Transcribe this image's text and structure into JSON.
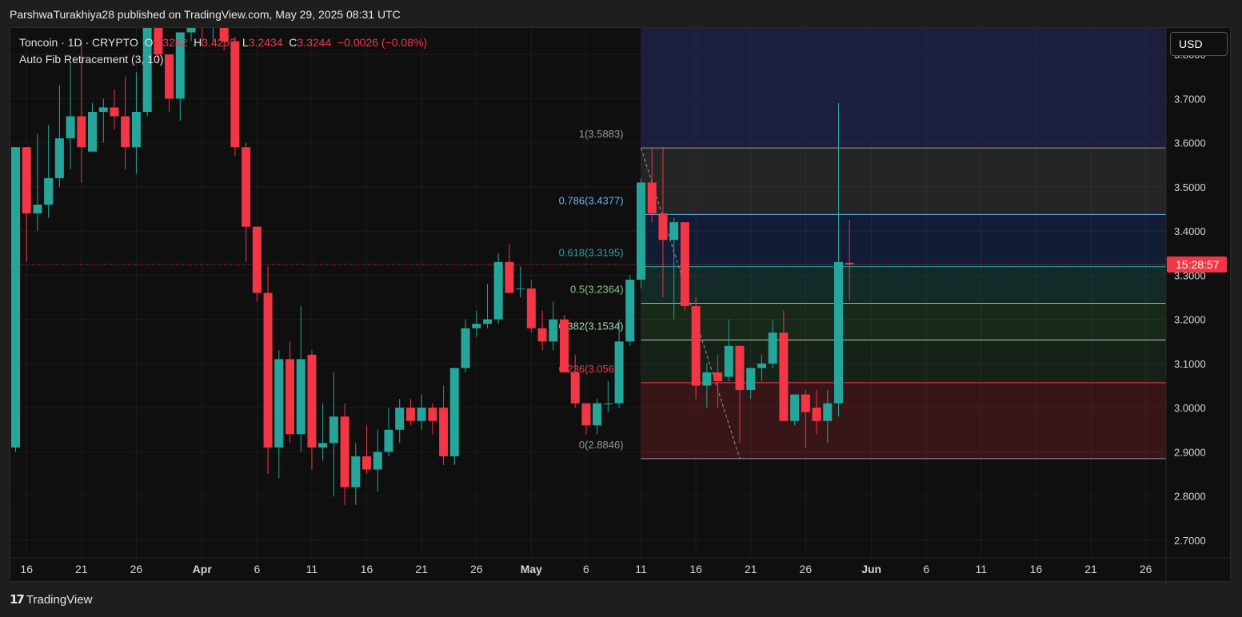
{
  "header": {
    "published": "ParshwaTurakhiya28 published on TradingView.com, May 29, 2025 08:31 UTC"
  },
  "legend": {
    "symbol": "Toncoin · 1D · CRYPTO",
    "o_label": "O",
    "o_value": "3.3282",
    "h_label": "H",
    "h_value": "3.4253",
    "l_label": "L",
    "l_value": "3.2434",
    "c_label": "C",
    "c_value": "3.3244",
    "change": "−0.0026 (−0.08%)",
    "indicator": "Auto Fib Retracement (3, 10)"
  },
  "currency_button": "USD",
  "countdown": "15:28:57",
  "footer": {
    "brand": "TradingView"
  },
  "colors": {
    "up": "#26a69a",
    "down": "#f23645",
    "background": "#0f0f0f"
  },
  "chart_data": {
    "type": "candlestick",
    "symbol": "Toncoin",
    "interval": "1D",
    "ylim": [
      2.66,
      3.86
    ],
    "y_ticks": [
      {
        "v": 2.7,
        "label": "2.7000"
      },
      {
        "v": 2.8,
        "label": "2.8000"
      },
      {
        "v": 2.9,
        "label": "2.9000"
      },
      {
        "v": 3.0,
        "label": "3.0000"
      },
      {
        "v": 3.1,
        "label": "3.1000"
      },
      {
        "v": 3.2,
        "label": "3.2000"
      },
      {
        "v": 3.3,
        "label": "3.3000"
      },
      {
        "v": 3.4,
        "label": "3.4000"
      },
      {
        "v": 3.5,
        "label": "3.5000"
      },
      {
        "v": 3.6,
        "label": "3.6000"
      },
      {
        "v": 3.7,
        "label": "3.7000"
      },
      {
        "v": 3.8,
        "label": "3.8000"
      }
    ],
    "x_ticks": [
      {
        "i": 1,
        "label": "16"
      },
      {
        "i": 6,
        "label": "21"
      },
      {
        "i": 11,
        "label": "26"
      },
      {
        "i": 17,
        "label": "Apr"
      },
      {
        "i": 22,
        "label": "6"
      },
      {
        "i": 27,
        "label": "11"
      },
      {
        "i": 32,
        "label": "16"
      },
      {
        "i": 37,
        "label": "21"
      },
      {
        "i": 42,
        "label": "26"
      },
      {
        "i": 47,
        "label": "May"
      },
      {
        "i": 52,
        "label": "6"
      },
      {
        "i": 57,
        "label": "11"
      },
      {
        "i": 62,
        "label": "16"
      },
      {
        "i": 67,
        "label": "21"
      },
      {
        "i": 72,
        "label": "26"
      },
      {
        "i": 78,
        "label": "Jun"
      },
      {
        "i": 83,
        "label": "6"
      },
      {
        "i": 88,
        "label": "11"
      },
      {
        "i": 93,
        "label": "16"
      },
      {
        "i": 98,
        "label": "21"
      },
      {
        "i": 103,
        "label": "26"
      }
    ],
    "candles": [
      {
        "i": 0,
        "o": 2.91,
        "h": 3.59,
        "l": 2.9,
        "c": 3.59
      },
      {
        "i": 1,
        "o": 3.59,
        "h": 3.59,
        "l": 3.33,
        "c": 3.44
      },
      {
        "i": 2,
        "o": 3.44,
        "h": 3.62,
        "l": 3.4,
        "c": 3.46
      },
      {
        "i": 3,
        "o": 3.46,
        "h": 3.64,
        "l": 3.43,
        "c": 3.52
      },
      {
        "i": 4,
        "o": 3.52,
        "h": 3.73,
        "l": 3.5,
        "c": 3.61
      },
      {
        "i": 5,
        "o": 3.61,
        "h": 3.78,
        "l": 3.54,
        "c": 3.66
      },
      {
        "i": 6,
        "o": 3.66,
        "h": 3.83,
        "l": 3.51,
        "c": 3.59
      },
      {
        "i": 7,
        "o": 3.58,
        "h": 3.69,
        "l": 3.58,
        "c": 3.67
      },
      {
        "i": 8,
        "o": 3.67,
        "h": 3.7,
        "l": 3.6,
        "c": 3.68
      },
      {
        "i": 9,
        "o": 3.68,
        "h": 3.72,
        "l": 3.63,
        "c": 3.66
      },
      {
        "i": 10,
        "o": 3.66,
        "h": 3.75,
        "l": 3.54,
        "c": 3.59
      },
      {
        "i": 11,
        "o": 3.59,
        "h": 3.76,
        "l": 3.53,
        "c": 3.67
      },
      {
        "i": 12,
        "o": 3.67,
        "h": 3.88,
        "l": 3.66,
        "c": 3.88
      },
      {
        "i": 13,
        "o": 3.88,
        "h": 3.9,
        "l": 3.78,
        "c": 3.8
      },
      {
        "i": 14,
        "o": 3.8,
        "h": 3.8,
        "l": 3.67,
        "c": 3.7
      },
      {
        "i": 15,
        "o": 3.7,
        "h": 3.85,
        "l": 3.65,
        "c": 3.85
      },
      {
        "i": 16,
        "o": 3.85,
        "h": 3.9,
        "l": 3.83,
        "c": 3.89
      },
      {
        "i": 17,
        "o": 3.89,
        "h": 3.9,
        "l": 3.82,
        "c": 3.86
      },
      {
        "i": 18,
        "o": 3.86,
        "h": 3.88,
        "l": 3.83,
        "c": 3.87
      },
      {
        "i": 19,
        "o": 3.87,
        "h": 3.88,
        "l": 3.81,
        "c": 3.83
      },
      {
        "i": 20,
        "o": 3.83,
        "h": 3.84,
        "l": 3.57,
        "c": 3.59
      },
      {
        "i": 21,
        "o": 3.59,
        "h": 3.6,
        "l": 3.33,
        "c": 3.41
      },
      {
        "i": 22,
        "o": 3.41,
        "h": 3.41,
        "l": 3.24,
        "c": 3.26
      },
      {
        "i": 23,
        "o": 3.26,
        "h": 3.32,
        "l": 2.85,
        "c": 2.91
      },
      {
        "i": 24,
        "o": 2.91,
        "h": 3.13,
        "l": 2.84,
        "c": 3.11
      },
      {
        "i": 25,
        "o": 3.11,
        "h": 3.15,
        "l": 2.92,
        "c": 2.94
      },
      {
        "i": 26,
        "o": 2.94,
        "h": 3.23,
        "l": 2.9,
        "c": 3.11
      },
      {
        "i": 27,
        "o": 3.12,
        "h": 3.13,
        "l": 2.86,
        "c": 2.91
      },
      {
        "i": 28,
        "o": 2.91,
        "h": 3.01,
        "l": 2.88,
        "c": 2.92
      },
      {
        "i": 29,
        "o": 2.92,
        "h": 3.08,
        "l": 2.8,
        "c": 2.98
      },
      {
        "i": 30,
        "o": 2.98,
        "h": 3.01,
        "l": 2.78,
        "c": 2.82
      },
      {
        "i": 31,
        "o": 2.82,
        "h": 2.92,
        "l": 2.78,
        "c": 2.89
      },
      {
        "i": 32,
        "o": 2.89,
        "h": 2.96,
        "l": 2.85,
        "c": 2.86
      },
      {
        "i": 33,
        "o": 2.86,
        "h": 2.95,
        "l": 2.81,
        "c": 2.9
      },
      {
        "i": 34,
        "o": 2.9,
        "h": 3.0,
        "l": 2.89,
        "c": 2.95
      },
      {
        "i": 35,
        "o": 2.95,
        "h": 3.02,
        "l": 2.92,
        "c": 3.0
      },
      {
        "i": 36,
        "o": 3.0,
        "h": 3.02,
        "l": 2.96,
        "c": 2.97
      },
      {
        "i": 37,
        "o": 2.97,
        "h": 3.03,
        "l": 2.95,
        "c": 3.0
      },
      {
        "i": 38,
        "o": 3.0,
        "h": 3.01,
        "l": 2.94,
        "c": 2.97
      },
      {
        "i": 39,
        "o": 3.0,
        "h": 3.05,
        "l": 2.87,
        "c": 2.89
      },
      {
        "i": 40,
        "o": 2.89,
        "h": 3.09,
        "l": 2.87,
        "c": 3.09
      },
      {
        "i": 41,
        "o": 3.09,
        "h": 3.2,
        "l": 3.08,
        "c": 3.18
      },
      {
        "i": 42,
        "o": 3.18,
        "h": 3.22,
        "l": 3.16,
        "c": 3.19
      },
      {
        "i": 43,
        "o": 3.19,
        "h": 3.28,
        "l": 3.18,
        "c": 3.2
      },
      {
        "i": 44,
        "o": 3.2,
        "h": 3.35,
        "l": 3.19,
        "c": 3.33
      },
      {
        "i": 45,
        "o": 3.33,
        "h": 3.37,
        "l": 3.26,
        "c": 3.26
      },
      {
        "i": 46,
        "o": 3.27,
        "h": 3.32,
        "l": 3.25,
        "c": 3.27
      },
      {
        "i": 47,
        "o": 3.27,
        "h": 3.29,
        "l": 3.17,
        "c": 3.18
      },
      {
        "i": 48,
        "o": 3.18,
        "h": 3.22,
        "l": 3.13,
        "c": 3.15
      },
      {
        "i": 49,
        "o": 3.15,
        "h": 3.24,
        "l": 3.13,
        "c": 3.2
      },
      {
        "i": 50,
        "o": 3.2,
        "h": 3.21,
        "l": 3.08,
        "c": 3.08
      },
      {
        "i": 51,
        "o": 3.08,
        "h": 3.12,
        "l": 3.0,
        "c": 3.01
      },
      {
        "i": 52,
        "o": 3.01,
        "h": 3.01,
        "l": 2.94,
        "c": 2.96
      },
      {
        "i": 53,
        "o": 2.96,
        "h": 3.02,
        "l": 2.94,
        "c": 3.01
      },
      {
        "i": 54,
        "o": 3.01,
        "h": 3.06,
        "l": 2.99,
        "c": 3.01
      },
      {
        "i": 55,
        "o": 3.01,
        "h": 3.2,
        "l": 3.0,
        "c": 3.15
      },
      {
        "i": 56,
        "o": 3.15,
        "h": 3.3,
        "l": 3.14,
        "c": 3.29
      },
      {
        "i": 57,
        "o": 3.29,
        "h": 3.52,
        "l": 3.27,
        "c": 3.51
      },
      {
        "i": 58,
        "o": 3.51,
        "h": 3.59,
        "l": 3.42,
        "c": 3.44
      },
      {
        "i": 59,
        "o": 3.44,
        "h": 3.59,
        "l": 3.25,
        "c": 3.38
      },
      {
        "i": 60,
        "o": 3.38,
        "h": 3.43,
        "l": 3.2,
        "c": 3.42
      },
      {
        "i": 61,
        "o": 3.42,
        "h": 3.42,
        "l": 3.22,
        "c": 3.23
      },
      {
        "i": 62,
        "o": 3.23,
        "h": 3.25,
        "l": 3.02,
        "c": 3.05
      },
      {
        "i": 63,
        "o": 3.05,
        "h": 3.1,
        "l": 3.0,
        "c": 3.08
      },
      {
        "i": 64,
        "o": 3.08,
        "h": 3.12,
        "l": 3.0,
        "c": 3.06
      },
      {
        "i": 65,
        "o": 3.07,
        "h": 3.2,
        "l": 3.06,
        "c": 3.14
      },
      {
        "i": 66,
        "o": 3.14,
        "h": 3.14,
        "l": 2.92,
        "c": 3.04
      },
      {
        "i": 67,
        "o": 3.04,
        "h": 3.09,
        "l": 3.02,
        "c": 3.09
      },
      {
        "i": 68,
        "o": 3.09,
        "h": 3.12,
        "l": 3.06,
        "c": 3.1
      },
      {
        "i": 69,
        "o": 3.1,
        "h": 3.2,
        "l": 3.09,
        "c": 3.17
      },
      {
        "i": 70,
        "o": 3.17,
        "h": 3.22,
        "l": 2.97,
        "c": 2.97
      },
      {
        "i": 71,
        "o": 2.97,
        "h": 3.03,
        "l": 2.96,
        "c": 3.03
      },
      {
        "i": 72,
        "o": 3.03,
        "h": 3.04,
        "l": 2.91,
        "c": 2.99
      },
      {
        "i": 73,
        "o": 3.0,
        "h": 3.04,
        "l": 2.94,
        "c": 2.97
      },
      {
        "i": 74,
        "o": 2.97,
        "h": 3.04,
        "l": 2.92,
        "c": 3.01
      },
      {
        "i": 75,
        "o": 3.01,
        "h": 3.69,
        "l": 2.98,
        "c": 3.33
      },
      {
        "i": 76,
        "o": 3.3282,
        "h": 3.4253,
        "l": 3.2434,
        "c": 3.3244
      }
    ],
    "fib_levels": [
      {
        "ratio_label": "1(3.5883)",
        "value": 3.5883,
        "color": "#9598a1"
      },
      {
        "ratio_label": "0.786(3.4377)",
        "value": 3.4377,
        "color": "#64b5f6"
      },
      {
        "ratio_label": "0.618(3.3195)",
        "value": 3.3195,
        "color": "#26a69a"
      },
      {
        "ratio_label": "0.5(3.2364)",
        "value": 3.2364,
        "color": "#81c784"
      },
      {
        "ratio_label": "0.382(3.1534)",
        "value": 3.1534,
        "color": "#a5d6a7"
      },
      {
        "ratio_label": "0.236(3.0567)",
        "value": 3.0567,
        "color": "#f23645"
      },
      {
        "ratio_label": "0(2.8846)",
        "value": 2.8846,
        "color": "#9598a1"
      }
    ],
    "fib_start_index": 57,
    "fib_end_index": 106,
    "fib_trend_from": {
      "i": 57,
      "v": 3.5883
    },
    "fib_trend_to": {
      "i": 66,
      "v": 2.8846
    },
    "last_price": 3.3244
  }
}
